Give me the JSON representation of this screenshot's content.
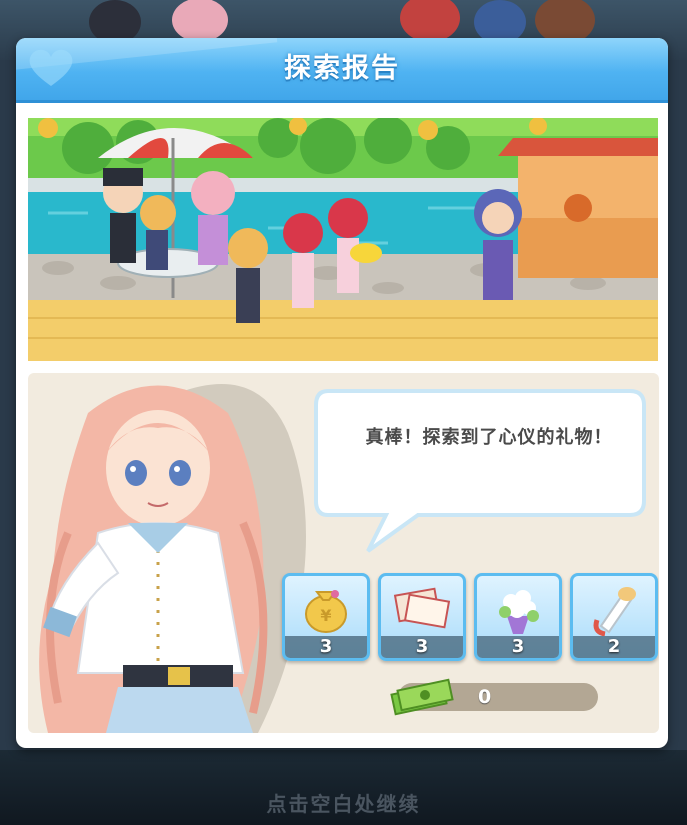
{
  "dialog": {
    "title": "探索报告"
  },
  "dialogue": {
    "text": "真棒！探索到了心仪的礼物！"
  },
  "rewards": [
    {
      "icon": "money-bag-icon",
      "count": "3"
    },
    {
      "icon": "gift-card-icon",
      "count": "3"
    },
    {
      "icon": "flower-bouquet-icon",
      "count": "3"
    },
    {
      "icon": "ice-cream-icon",
      "count": "2"
    }
  ],
  "currency": {
    "icon": "cash-stack-icon",
    "value": "0"
  },
  "footer": {
    "continue_hint": "点击空白处继续"
  },
  "colors": {
    "header_blue": "#4fb3f2",
    "panel_bg": "#f2ebdf",
    "item_border": "#5cbcf0"
  }
}
